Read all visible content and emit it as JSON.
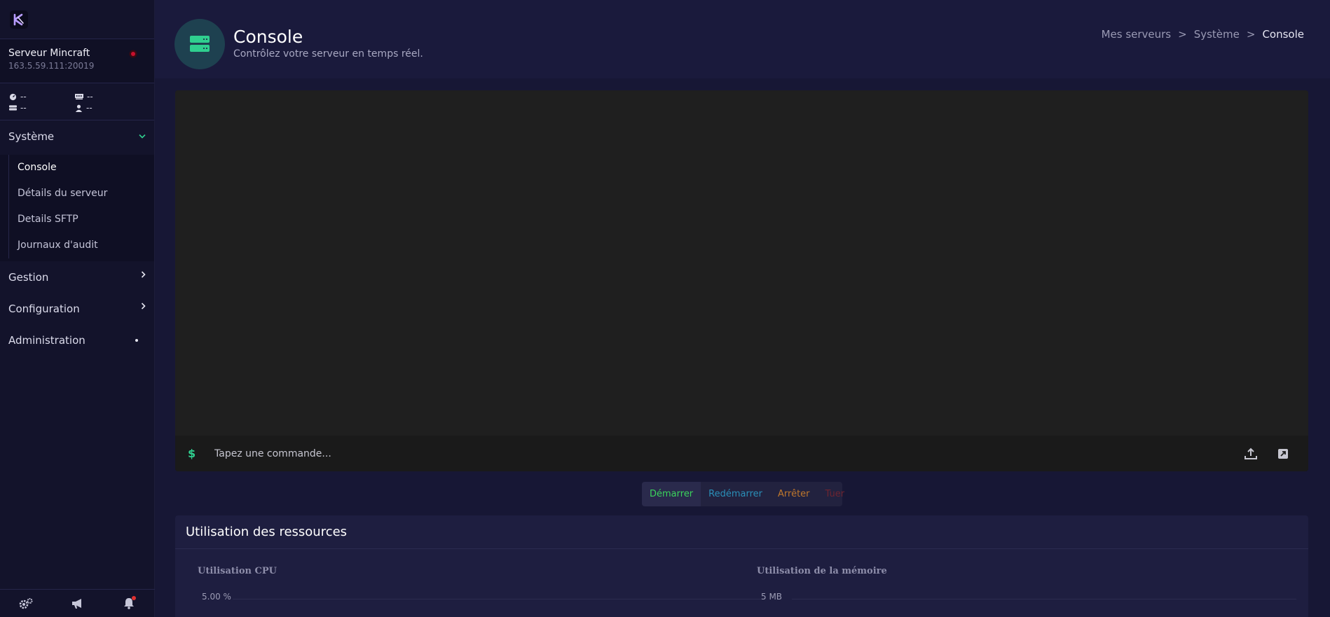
{
  "app": {
    "brand_color": "#2fcf8f",
    "status_color": "#c8102e"
  },
  "sidebar": {
    "server_name": "Serveur Mincraft",
    "server_ip": "163.5.59.111:20019",
    "stats": {
      "cpu": "--",
      "memory": "--",
      "disk": "--",
      "players": "--"
    },
    "system_label": "Système",
    "system_items": [
      {
        "label": "Console",
        "active": true
      },
      {
        "label": "Détails du serveur"
      },
      {
        "label": "Details SFTP"
      },
      {
        "label": "Journaux d'audit"
      }
    ],
    "gestion_label": "Gestion",
    "configuration_label": "Configuration",
    "administration_label": "Administration"
  },
  "header": {
    "title": "Console",
    "subtitle": "Contrôlez votre serveur en temps réel.",
    "breadcrumb": [
      "Mes serveurs",
      ">",
      "Système",
      ">",
      "Console"
    ]
  },
  "console": {
    "prompt": "$",
    "placeholder": "Tapez une commande..."
  },
  "power": {
    "start": "Démarrer",
    "restart": "Redémarrer",
    "stop": "Arrêter",
    "kill": "Tuer"
  },
  "resources": {
    "title": "Utilisation des ressources",
    "cpu_label": "Utilisation CPU",
    "cpu_value": "5.00 %",
    "memory_label": "Utilisation de la mémoire",
    "memory_value": "5 MB"
  }
}
